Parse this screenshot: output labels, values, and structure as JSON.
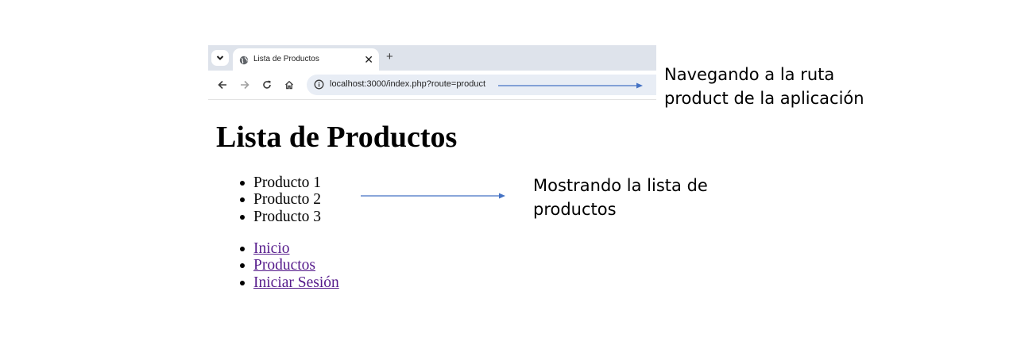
{
  "browser": {
    "tab_title": "Lista de Productos",
    "url": "localhost:3000/index.php?route=product",
    "close_glyph": "✕",
    "newtab_glyph": "+"
  },
  "page": {
    "title": "Lista de Productos",
    "products": [
      "Producto 1",
      "Producto 2",
      "Producto 3"
    ],
    "links": [
      "Inicio",
      "Productos",
      "Iniciar Sesión"
    ]
  },
  "annotations": {
    "route_note": [
      "Navegando a la ruta",
      "product de la aplicación"
    ],
    "list_note": [
      "Mostrando la lista de",
      "productos"
    ]
  },
  "colors": {
    "arrow": "#4472c4",
    "link_visited": "#551a8b",
    "tabstrip": "#dee3eb",
    "omnibox": "#e8edf5"
  },
  "icons": [
    "chevron-down-icon",
    "globe-icon",
    "close-icon",
    "plus-icon",
    "back-arrow-icon",
    "forward-arrow-icon",
    "reload-icon",
    "home-icon",
    "info-icon"
  ]
}
